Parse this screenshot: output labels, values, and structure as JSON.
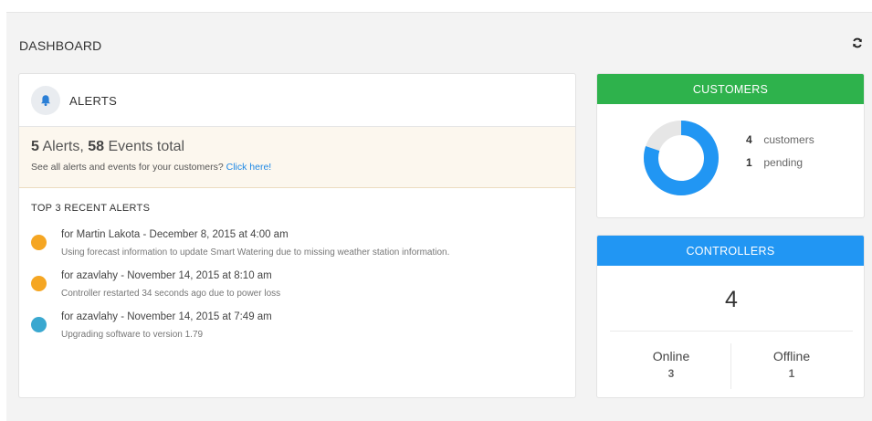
{
  "header": {
    "title": "DASHBOARD",
    "refresh_icon": "refresh-icon"
  },
  "alerts": {
    "title": "ALERTS",
    "icon": "bell-icon",
    "summary": {
      "alerts_count": "5",
      "alerts_word": " Alerts, ",
      "events_count": "58",
      "events_word": " Events total",
      "sub_text": "See all alerts and events for your customers? ",
      "link_text": "Click here!"
    },
    "recent_title": "TOP 3 RECENT ALERTS",
    "items": [
      {
        "title": "for Martin Lakota - December 8, 2015 at 4:00 am",
        "detail": "Using forecast information to update Smart Watering due to missing weather station information.",
        "color": "#f5a623"
      },
      {
        "title": "for azavlahy - November 14, 2015 at 8:10 am",
        "detail": "Controller restarted 34 seconds ago due to power loss",
        "color": "#f5a623"
      },
      {
        "title": "for azavlahy - November 14, 2015 at 7:49 am",
        "detail": "Upgrading software to version 1.79",
        "color": "#3aa8d0"
      }
    ]
  },
  "customers": {
    "title": "CUSTOMERS",
    "header_color": "#2eb24c",
    "customers_count": "4",
    "customers_label": "customers",
    "pending_count": "1",
    "pending_label": "pending",
    "donut": {
      "active": 4,
      "pending": 1,
      "active_color": "#2196f3",
      "pending_color": "#e6e6e6"
    }
  },
  "controllers": {
    "title": "CONTROLLERS",
    "header_color": "#2196f3",
    "total": "4",
    "online_label": "Online",
    "online_value": "3",
    "offline_label": "Offline",
    "offline_value": "1"
  }
}
